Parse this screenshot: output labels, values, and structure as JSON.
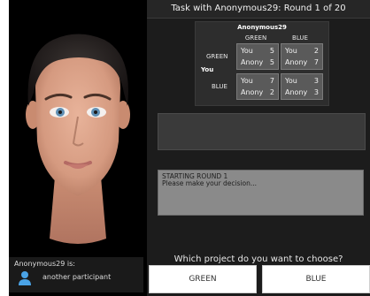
{
  "header": {
    "title": "Task with Anonymous29: Round 1 of 20"
  },
  "payoff": {
    "opponent_name": "Anonymous29",
    "col_labels": [
      "GREEN",
      "BLUE"
    ],
    "row_labels": [
      "GREEN",
      "BLUE"
    ],
    "you_label": "You",
    "cells": [
      {
        "you_label": "You",
        "you_value": "5",
        "opp_label": "Anony",
        "opp_value": "5"
      },
      {
        "you_label": "You",
        "you_value": "2",
        "opp_label": "Anony",
        "opp_value": "7"
      },
      {
        "you_label": "You",
        "you_value": "7",
        "opp_label": "Anony",
        "opp_value": "2"
      },
      {
        "you_label": "You",
        "you_value": "3",
        "opp_label": "Anony",
        "opp_value": "3"
      }
    ]
  },
  "message": {
    "line1": "STARTING ROUND 1",
    "line2": "Please make your decision..."
  },
  "question": "Which project do you want to choose?",
  "buttons": {
    "green": "GREEN",
    "blue": "BLUE"
  },
  "participant": {
    "title": "Anonymous29 is:",
    "description": "another participant"
  },
  "colors": {
    "background": "#1c1c1c",
    "cell": "#5a5a5a",
    "message_box": "#8a8a8a",
    "button": "#ffffff"
  }
}
